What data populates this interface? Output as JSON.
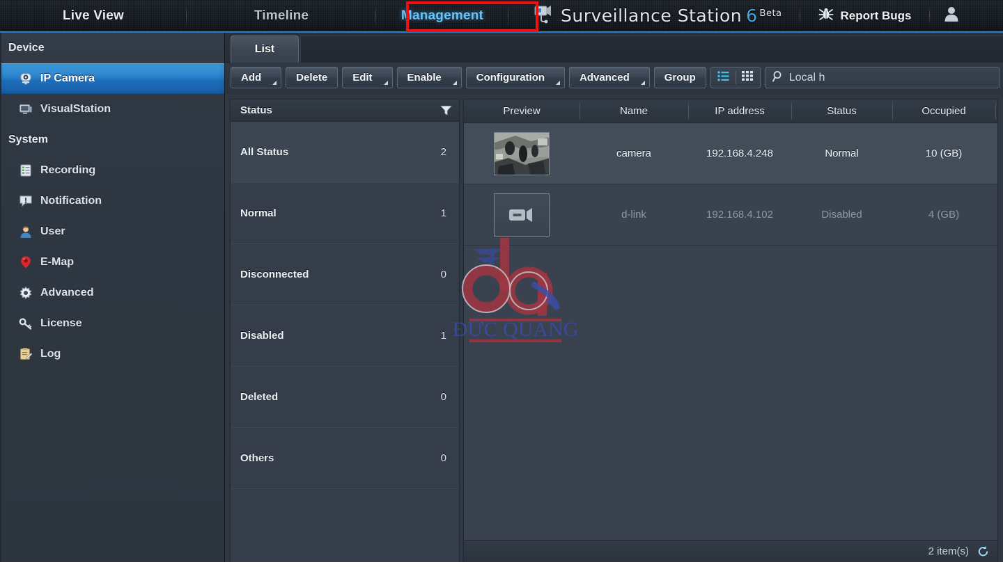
{
  "topbar": {
    "tabs": [
      {
        "label": "Live View",
        "active": false
      },
      {
        "label": "Timeline",
        "active": false
      },
      {
        "label": "Management",
        "active": true
      }
    ],
    "brand": {
      "name": "Surveillance Station",
      "version": "6",
      "beta": "Beta",
      "icon": "camera-icon"
    },
    "report_bugs": {
      "label": "Report Bugs",
      "icon": "bug-icon"
    },
    "user": {
      "icon": "user-avatar-icon"
    },
    "highlight_color": "#f10f0f",
    "accent_color": "#6cc4f5"
  },
  "sidebar": {
    "groups": [
      {
        "title": "Device",
        "items": [
          {
            "label": "IP Camera",
            "icon": "ip-camera-icon",
            "active": true
          },
          {
            "label": "VisualStation",
            "icon": "visualstation-icon",
            "active": false
          }
        ]
      },
      {
        "title": "System",
        "items": [
          {
            "label": "Recording",
            "icon": "recording-icon",
            "active": false
          },
          {
            "label": "Notification",
            "icon": "notification-icon",
            "active": false
          },
          {
            "label": "User",
            "icon": "user-icon",
            "active": false
          },
          {
            "label": "E-Map",
            "icon": "emap-pin-icon",
            "active": false
          },
          {
            "label": "Advanced",
            "icon": "gear-icon",
            "active": false
          },
          {
            "label": "License",
            "icon": "key-icon",
            "active": false
          },
          {
            "label": "Log",
            "icon": "log-clipboard-icon",
            "active": false
          }
        ]
      }
    ]
  },
  "main": {
    "tab": {
      "label": "List"
    },
    "toolbar": {
      "buttons": [
        {
          "label": "Add",
          "dropdown": true
        },
        {
          "label": "Delete",
          "dropdown": false
        },
        {
          "label": "Edit",
          "dropdown": true
        },
        {
          "label": "Enable",
          "dropdown": true
        },
        {
          "label": "Configuration",
          "dropdown": true
        },
        {
          "label": "Advanced",
          "dropdown": true
        },
        {
          "label": "Group",
          "dropdown": false
        }
      ],
      "view_toggle": [
        {
          "icon": "list-view-icon",
          "active": true
        },
        {
          "icon": "grid-view-icon",
          "active": false
        }
      ],
      "search": {
        "icon": "search-icon",
        "value": "Local h"
      }
    },
    "status_panel": {
      "title": "Status",
      "filter_icon": "funnel-filter-icon",
      "rows": [
        {
          "label": "All Status",
          "count": "2",
          "selected": true
        },
        {
          "label": "Normal",
          "count": "1",
          "selected": false
        },
        {
          "label": "Disconnected",
          "count": "0",
          "selected": false
        },
        {
          "label": "Disabled",
          "count": "1",
          "selected": false
        },
        {
          "label": "Deleted",
          "count": "0",
          "selected": false
        },
        {
          "label": "Others",
          "count": "0",
          "selected": false
        }
      ]
    },
    "table": {
      "columns": [
        "Preview",
        "Name",
        "IP address",
        "Status",
        "Occupied"
      ],
      "rows": [
        {
          "preview": "camera-snapshot-thumbnail",
          "name": "camera",
          "ip": "192.168.4.248",
          "status": "Normal",
          "occupied": "10 (GB)",
          "enabled": true
        },
        {
          "preview": "camera-offline-placeholder",
          "name": "d-link",
          "ip": "192.168.4.102",
          "status": "Disabled",
          "occupied": "4 (GB)",
          "enabled": false
        }
      ],
      "footer": {
        "count_label": "2 item(s)",
        "refresh_icon": "refresh-icon"
      }
    }
  },
  "watermark": {
    "logo": "dq-logo",
    "text": "ĐỨC QUANG",
    "color_red": "#9e3642",
    "color_blue": "#2f3f9e"
  }
}
